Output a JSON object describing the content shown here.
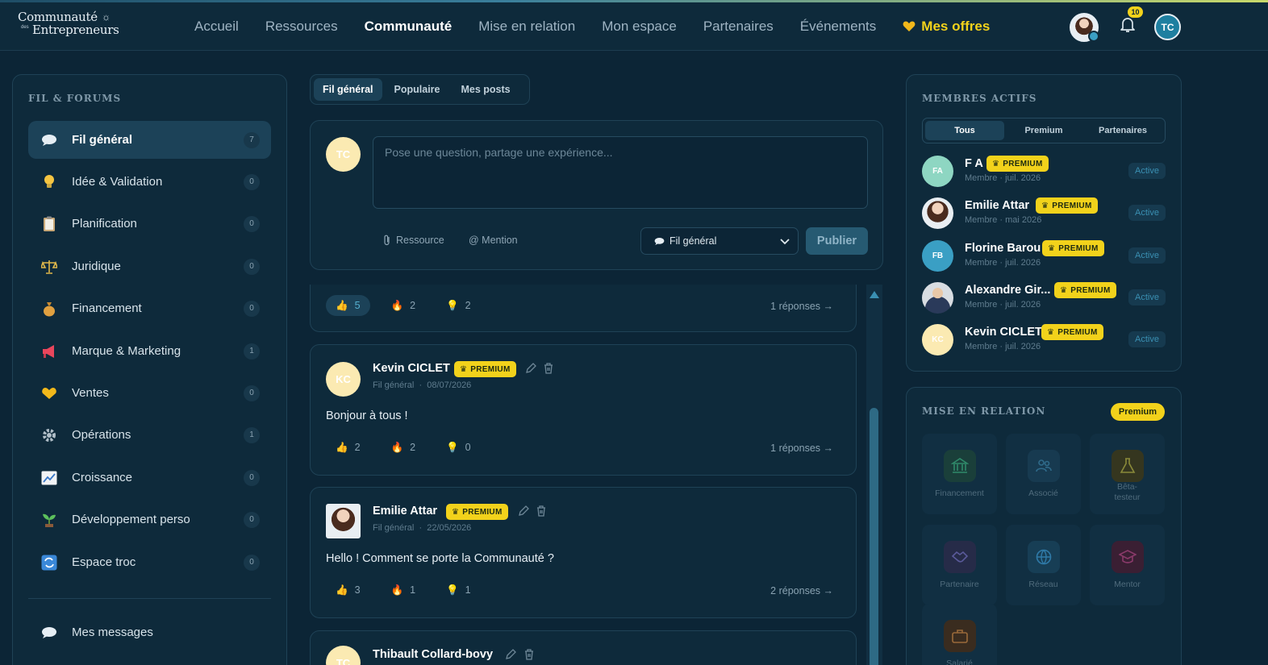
{
  "header": {
    "logo_line1": "Communauté",
    "logo_line2": "Entrepreneurs",
    "logo_small": "des",
    "nav": [
      "Accueil",
      "Ressources",
      "Communauté",
      "Mise en relation",
      "Mon espace",
      "Partenaires",
      "Événements"
    ],
    "active_nav": "Communauté",
    "offers_label": "Mes offres",
    "notifications_count": "10",
    "user_initials": "TC"
  },
  "sidebar": {
    "title": "FIL & FORUMS",
    "items": [
      {
        "label": "Fil général",
        "count": "7",
        "icon": "speech-bubble-icon"
      },
      {
        "label": "Idée & Validation",
        "count": "0",
        "icon": "lightbulb-icon"
      },
      {
        "label": "Planification",
        "count": "0",
        "icon": "clipboard-icon"
      },
      {
        "label": "Juridique",
        "count": "0",
        "icon": "scales-icon"
      },
      {
        "label": "Financement",
        "count": "0",
        "icon": "money-bag-icon"
      },
      {
        "label": "Marque & Marketing",
        "count": "1",
        "icon": "megaphone-icon"
      },
      {
        "label": "Ventes",
        "count": "0",
        "icon": "handshake-icon"
      },
      {
        "label": "Opérations",
        "count": "1",
        "icon": "gear-icon"
      },
      {
        "label": "Croissance",
        "count": "0",
        "icon": "chart-icon"
      },
      {
        "label": "Développement perso",
        "count": "0",
        "icon": "seedling-icon"
      },
      {
        "label": "Espace troc",
        "count": "0",
        "icon": "exchange-icon"
      }
    ],
    "messages_label": "Mes messages"
  },
  "feed_tabs": [
    "Fil général",
    "Populaire",
    "Mes posts"
  ],
  "composer": {
    "avatar": "TC",
    "placeholder": "Pose une question, partage une expérience...",
    "resource_label": "Ressource",
    "mention_label": "@ Mention",
    "channel": "Fil général",
    "publish_label": "Publier"
  },
  "posts": [
    {
      "reacts": [
        "5",
        "2",
        "2"
      ],
      "replies": "1 réponses →"
    },
    {
      "author": "Kevin CICLET",
      "avatar": "KC",
      "badge": "PREMIUM",
      "channel": "Fil général",
      "date": "08/07/2026",
      "body": "Bonjour à tous !",
      "reacts": [
        "2",
        "2",
        "0"
      ],
      "replies": "1 réponses →"
    },
    {
      "author": "Emilie Attar",
      "badge": "PREMIUM",
      "channel": "Fil général",
      "date": "22/05/2026",
      "body": "Hello ! Comment se porte la Communauté ?",
      "reacts": [
        "3",
        "1",
        "1"
      ],
      "replies": "2 réponses →"
    },
    {
      "author": "Thibault Collard-bovy",
      "avatar": "TC"
    }
  ],
  "members": {
    "title": "MEMBRES ACTIFS",
    "tabs": [
      "Tous",
      "Premium",
      "Partenaires"
    ],
    "list": [
      {
        "initials": "FA",
        "name": "F A",
        "badge": "PREMIUM",
        "sub": "Membre · juil. 2026",
        "status": "Active",
        "color": "#8ed6c2"
      },
      {
        "initials": "",
        "name": "Emilie Attar",
        "badge": "PREMIUM",
        "sub": "Membre · mai 2026",
        "status": "Active",
        "color": "#e9eef2"
      },
      {
        "initials": "FB",
        "name": "Florine Barou",
        "badge": "PREMIUM",
        "sub": "Membre · juil. 2026",
        "status": "Active",
        "color": "#3a9fc4"
      },
      {
        "initials": "",
        "name": "Alexandre Gir...",
        "badge": "PREMIUM",
        "sub": "Membre · juil. 2026",
        "status": "Active",
        "color": "#d8dde2"
      },
      {
        "initials": "KC",
        "name": "Kevin CICLET",
        "badge": "PREMIUM",
        "sub": "Membre · juil. 2026",
        "status": "Active",
        "color": "#fbeab2"
      }
    ]
  },
  "relation": {
    "title": "MISE EN RELATION",
    "pill": "Premium",
    "tiles": [
      {
        "label": "Financement",
        "color": "#1f6a55"
      },
      {
        "label": "Associé",
        "color": "#1c4258"
      },
      {
        "label": "Bêta-\ntesteur",
        "color": "#5a5a2a"
      },
      {
        "label": "Partenaire",
        "color": "#3a3a6a"
      },
      {
        "label": "Réseau",
        "color": "#1f5a7a"
      },
      {
        "label": "Mentor",
        "color": "#5a2a4a"
      },
      {
        "label": "Salarié",
        "color": "#6a4a2a"
      }
    ]
  }
}
